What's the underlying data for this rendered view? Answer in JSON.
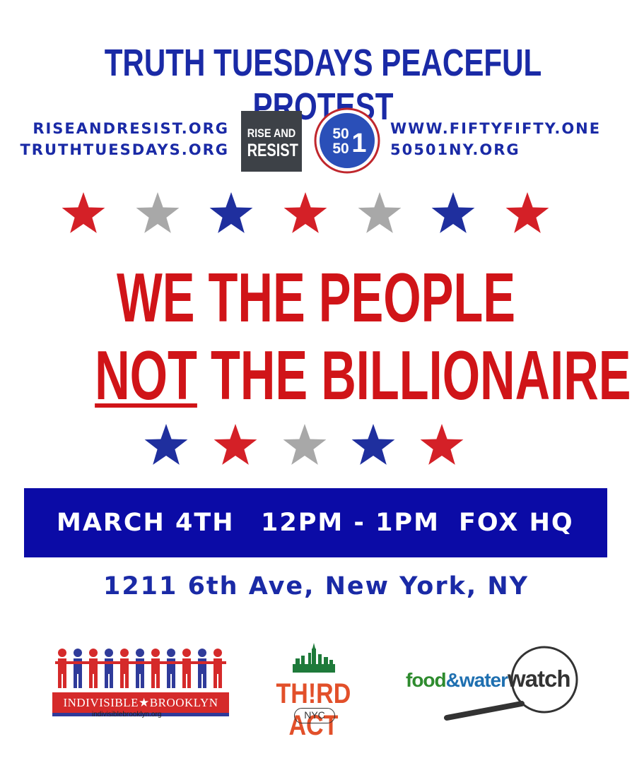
{
  "header": {
    "title": "TRUTH TUESDAYS PEACEFUL PROTEST",
    "links_left": [
      "RISEANDRESIST.ORG",
      "TRUTHTUESDAYS.ORG"
    ],
    "links_right": [
      "WWW.FIFTYFIFTY.ONE",
      "50501NY.ORG"
    ],
    "rise_resist_logo": {
      "line1": "RISE AND",
      "line2": "RESIST"
    },
    "fiftyfifty_logo": {
      "top": "50",
      "bottom": "50",
      "one": "1"
    }
  },
  "stars_top": [
    "red",
    "gray",
    "blue",
    "red",
    "gray",
    "blue",
    "red"
  ],
  "headline": {
    "line1": "WE THE PEOPLE",
    "line2_underlined": "NOT",
    "line2_rest": " THE BILLIONAIRES"
  },
  "stars_bottom": [
    "blue",
    "red",
    "gray",
    "blue",
    "red"
  ],
  "banner": {
    "date": "MARCH 4TH",
    "time": "12PM - 1PM",
    "place": "FOX HQ"
  },
  "address": "1211 6th Ave, New York, NY",
  "sponsors": {
    "indivisible": {
      "name": "INDIVISIBLE★BROOKLYN",
      "url": "indivisiblebrooklyn.org"
    },
    "third_act": {
      "name": "TH!RD ACT",
      "sub": "NYC"
    },
    "food_water_watch": {
      "part1": "food",
      "part2": "&water",
      "part3": "watch"
    }
  },
  "colors": {
    "blue": "#1a2aa6",
    "red": "#d01418",
    "banner_blue": "#0b0ba6",
    "star_red": "#d42027",
    "star_gray": "#a8a8a8",
    "star_blue": "#1f2f9e"
  }
}
